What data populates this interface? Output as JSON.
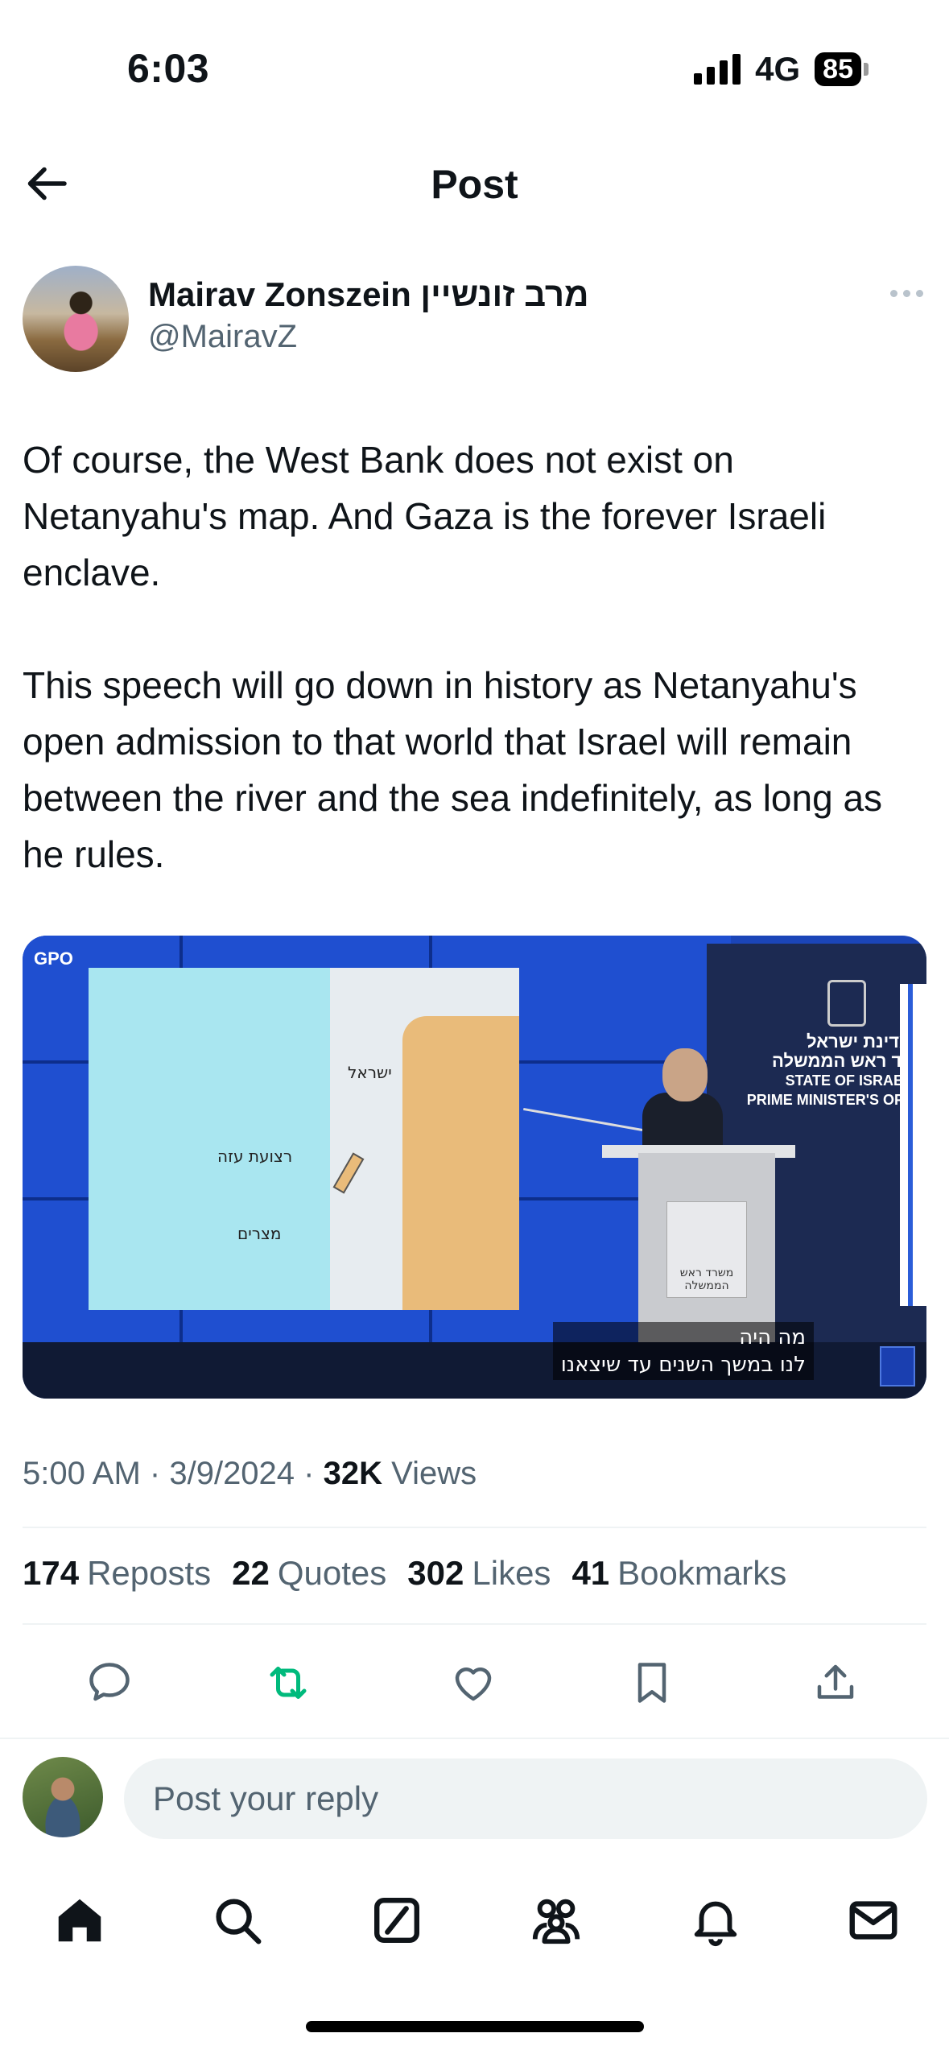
{
  "status_bar": {
    "time": "6:03",
    "network": "4G",
    "battery": "85"
  },
  "header": {
    "title": "Post"
  },
  "author": {
    "name": "Mairav Zonszein מרב זונשיין",
    "handle": "@MairavZ"
  },
  "post": {
    "paragraphs": [
      "Of course, the West Bank does not exist on Netanyahu's map. And Gaza is the forever Israeli enclave.",
      "This speech will go down in history as Netanyahu's open admission to that world that Israel will remain between the river and the sea indefinitely, as long as he rules."
    ]
  },
  "media": {
    "watermark": "GPO",
    "map_labels": {
      "israel": "ישראל",
      "gaza": "רצועת עזה",
      "egypt": "מצרים"
    },
    "backdrop_lines": [
      "מדינת ישראל",
      "רד ראש הממשלה",
      "STATE OF ISRAEL",
      "PRIME MINISTER'S OFF"
    ],
    "podium_sign": "משרד ראש הממשלה",
    "subtitle_lines": [
      "מה היה",
      "לנו במשך השנים עד שיצאנו"
    ]
  },
  "meta": {
    "time": "5:00 AM",
    "separator": "·",
    "date": "3/9/2024",
    "views_count": "32K",
    "views_label": "Views"
  },
  "stats": [
    {
      "count": "174",
      "label": "Reposts"
    },
    {
      "count": "22",
      "label": "Quotes"
    },
    {
      "count": "302",
      "label": "Likes"
    },
    {
      "count": "41",
      "label": "Bookmarks"
    }
  ],
  "actions": [
    "reply-icon",
    "repost-icon",
    "like-icon",
    "bookmark-icon",
    "share-icon"
  ],
  "colors": {
    "repost_active": "#00ba7c",
    "secondary_text": "#536471",
    "primary_text": "#0f1419"
  },
  "reply": {
    "placeholder": "Post your reply"
  },
  "bottom_nav": [
    "home-icon",
    "search-icon",
    "grok-icon",
    "communities-icon",
    "notifications-icon",
    "messages-icon"
  ]
}
